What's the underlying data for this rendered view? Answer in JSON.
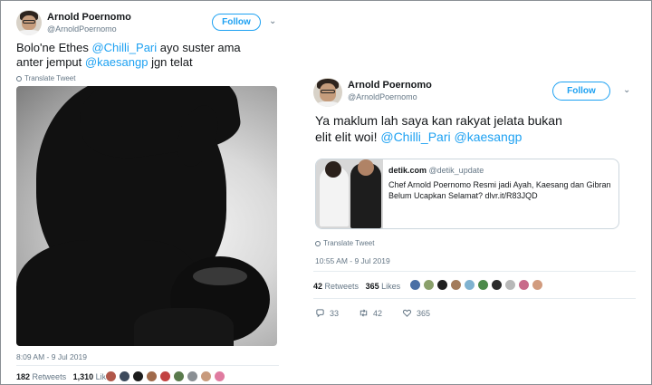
{
  "left_tweet": {
    "name": "Arnold Poernomo",
    "handle": "@ArnoldPoernomo",
    "follow_label": "Follow",
    "text_line1_a": "Bolo'ne Ethes ",
    "text_line1_mention": "@Chilli_Pari",
    "text_line1_b": " ayo suster ama",
    "text_line2_a": "anter jemput ",
    "text_line2_mention": "@kaesangp",
    "text_line2_b": " jgn telat",
    "translate": "Translate Tweet",
    "timestamp": "8:09 AM - 9 Jul 2019",
    "retweets_count": "182",
    "retweets_label": "Retweets",
    "likes_count": "1,310",
    "likes_label": "Likes"
  },
  "right_tweet": {
    "name": "Arnold Poernomo",
    "handle": "@ArnoldPoernomo",
    "follow_label": "Follow",
    "text_line1": "Ya maklum lah saya kan rakyat jelata bukan",
    "text_line2_a": "elit elit woi! ",
    "mention1": "@Chilli_Pari",
    "mention2": "@kaesangp",
    "card": {
      "site": "detik.com",
      "site_handle": "@detik_update",
      "desc": "Chef Arnold Poernomo Resmi jadi Ayah, Kaesang dan Gibran Belum Ucapkan Selamat? dlvr.it/R83JQD"
    },
    "translate": "Translate Tweet",
    "timestamp": "10:55 AM - 9 Jul 2019",
    "retweets_count": "42",
    "retweets_label": "Retweets",
    "likes_count": "365",
    "likes_label": "Likes",
    "actions": {
      "replies": "33",
      "retweets": "42",
      "likes": "365"
    }
  },
  "colors": {
    "accent": "#1da1f2",
    "muted": "#657786",
    "text": "#14171a"
  },
  "icons": [
    "chevron-down-icon",
    "globe-icon",
    "reply-icon",
    "retweet-icon",
    "heart-icon"
  ]
}
